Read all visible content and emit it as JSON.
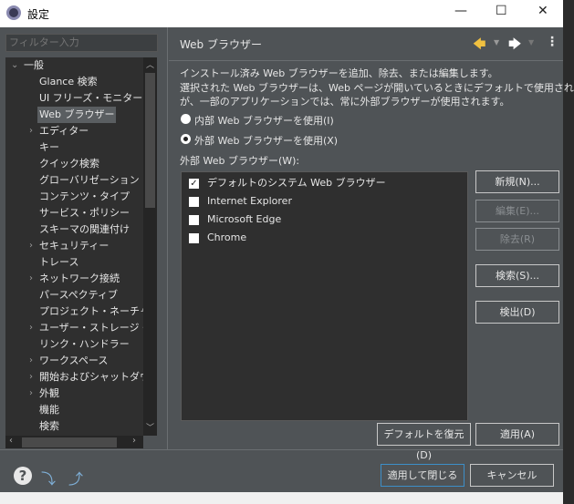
{
  "window": {
    "title": "設定",
    "minimize": "—",
    "maximize": "☐",
    "close": "✕"
  },
  "filter": {
    "placeholder": "フィルター入力"
  },
  "tree": [
    {
      "label": "一般",
      "expanded": true,
      "level": 0
    },
    {
      "label": "Glance 検索",
      "level": 1
    },
    {
      "label": "UI フリーズ・モニター",
      "level": 1
    },
    {
      "label": "Web ブラウザー",
      "level": 1,
      "selected": true
    },
    {
      "label": "エディター",
      "level": 1,
      "expandable": true
    },
    {
      "label": "キー",
      "level": 1
    },
    {
      "label": "クイック検索",
      "level": 1
    },
    {
      "label": "グローバリゼーション",
      "level": 1
    },
    {
      "label": "コンテンツ・タイプ",
      "level": 1
    },
    {
      "label": "サービス・ポリシー",
      "level": 1
    },
    {
      "label": "スキーマの関連付け",
      "level": 1
    },
    {
      "label": "セキュリティー",
      "level": 1,
      "expandable": true
    },
    {
      "label": "トレース",
      "level": 1
    },
    {
      "label": "ネットワーク接続",
      "level": 1,
      "expandable": true
    },
    {
      "label": "パースペクティブ",
      "level": 1
    },
    {
      "label": "プロジェクト・ネーチャー",
      "level": 1
    },
    {
      "label": "ユーザー・ストレージ・サー",
      "level": 1,
      "expandable": true
    },
    {
      "label": "リンク・ハンドラー",
      "level": 1
    },
    {
      "label": "ワークスペース",
      "level": 1,
      "expandable": true
    },
    {
      "label": "開始およびシャットダウン",
      "level": 1,
      "expandable": true
    },
    {
      "label": "外観",
      "level": 1,
      "expandable": true
    },
    {
      "label": "機能",
      "level": 1
    },
    {
      "label": "検索",
      "level": 1
    }
  ],
  "page": {
    "title": "Web ブラウザー",
    "description": [
      "インストール済み Web ブラウザーを追加、除去、または編集します。",
      "選択された Web ブラウザーは、Web ページが開いているときにデフォルトで使用されます",
      "が、一部のアプリケーションでは、常に外部ブラウザーが使用されます。"
    ],
    "radio_internal": "内部 Web ブラウザーを使用(I)",
    "radio_external": "外部 Web ブラウザーを使用(X)",
    "selected_radio": "external",
    "list_label": "外部 Web ブラウザー(W):",
    "browsers": [
      {
        "name": "デフォルトのシステム Web ブラウザー",
        "checked": true
      },
      {
        "name": "Internet Explorer",
        "checked": false
      },
      {
        "name": "Microsoft Edge",
        "checked": false
      },
      {
        "name": "Chrome",
        "checked": false
      }
    ],
    "buttons": {
      "new": "新規(N)...",
      "edit": "編集(E)...",
      "remove": "除去(R)",
      "search": "検索(S)...",
      "detect": "検出(D)",
      "restore": "デフォルトを復元(D)",
      "apply": "適用(A)"
    }
  },
  "footer": {
    "apply_close": "適用して閉じる",
    "cancel": "キャンセル"
  },
  "colors": {
    "accent": "#3d8fc8",
    "back_arrow": "#f0c040"
  }
}
